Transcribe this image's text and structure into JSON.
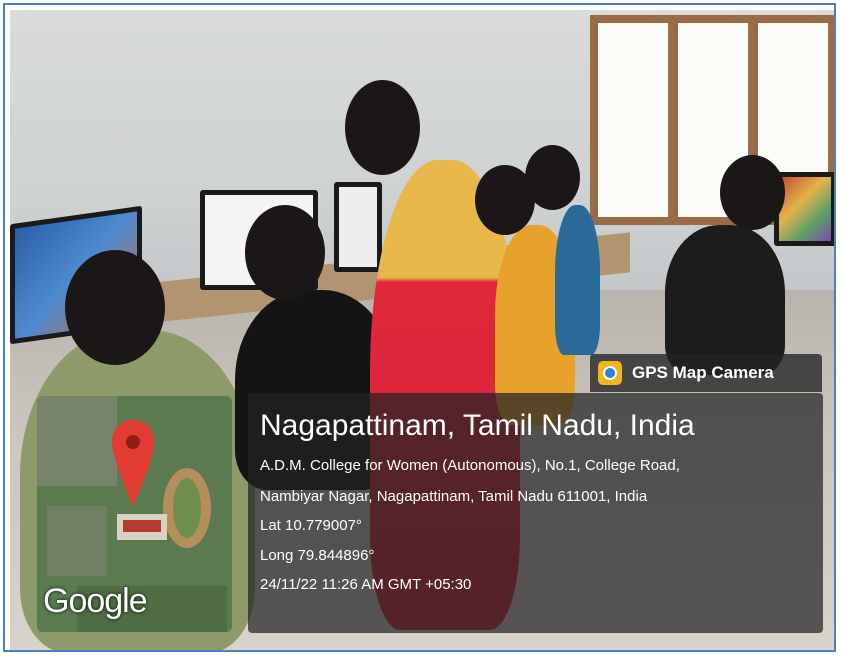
{
  "badge": {
    "label": "GPS Map Camera",
    "icon": "gps-map-camera-icon"
  },
  "location": {
    "title": "Nagapattinam, Tamil Nadu, India",
    "address_line1": "A.D.M. College for Women (Autonomous), No.1, College Road,",
    "address_line2": "Nambiyar Nagar, Nagapattinam, Tamil Nadu 611001, India",
    "lat": "Lat 10.779007°",
    "long": "Long 79.844896°",
    "datetime": "24/11/22 11:26 AM GMT +05:30"
  },
  "map": {
    "brand": "Google",
    "marker_icon": "map-pin-icon"
  },
  "colors": {
    "frame": "#4a7fc1",
    "overlay": "#222224",
    "pin": "#e23b32",
    "badge_icon": "#f2b61d"
  }
}
